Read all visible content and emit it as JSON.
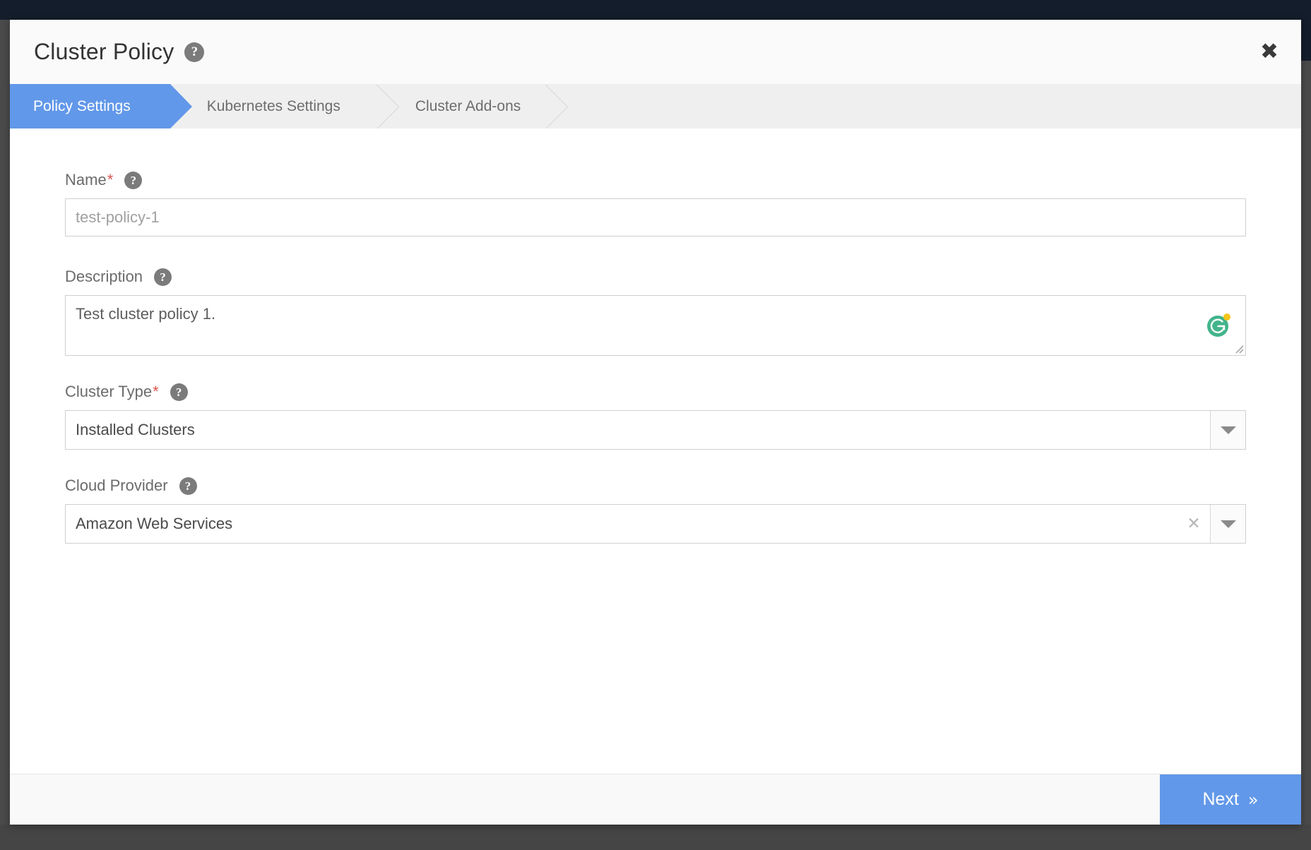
{
  "window": {
    "title": "Cluster Policy",
    "title_help_icon": "help-circle-icon",
    "close_icon": "close-icon",
    "accent_color": "#6298e9",
    "required_marker_color": "#d9534f",
    "backdrop_color": "#141d2b"
  },
  "tabs": [
    {
      "label": "Policy Settings",
      "active": true
    },
    {
      "label": "Kubernetes Settings",
      "active": false
    },
    {
      "label": "Cluster Add-ons",
      "active": false
    }
  ],
  "form": {
    "name": {
      "label": "Name",
      "required_marker": "*",
      "help_icon": "help-circle-icon",
      "value": "",
      "placeholder": "test-policy-1"
    },
    "description": {
      "label": "Description",
      "help_icon": "help-circle-icon",
      "value": "Test cluster policy 1.",
      "placeholder": "",
      "grammarly_icon": "grammarly-icon",
      "grammarly_color": "#42b48c",
      "grammarly_dot_color": "#f5c518",
      "resize_handle_icon": "resize-handle-icon"
    },
    "cluster_type": {
      "label": "Cluster Type",
      "required_marker": "*",
      "help_icon": "help-circle-icon",
      "value": "Installed Clusters",
      "dropdown_icon": "chevron-down-icon"
    },
    "cloud_provider": {
      "label": "Cloud Provider",
      "help_icon": "help-circle-icon",
      "value": "Amazon Web Services",
      "clear_icon": "close-icon",
      "dropdown_icon": "chevron-down-icon"
    }
  },
  "footer": {
    "next_label": "Next",
    "next_chevrons": "»"
  },
  "glyphs": {
    "help": "?",
    "close": "✖",
    "clear": "✕"
  }
}
